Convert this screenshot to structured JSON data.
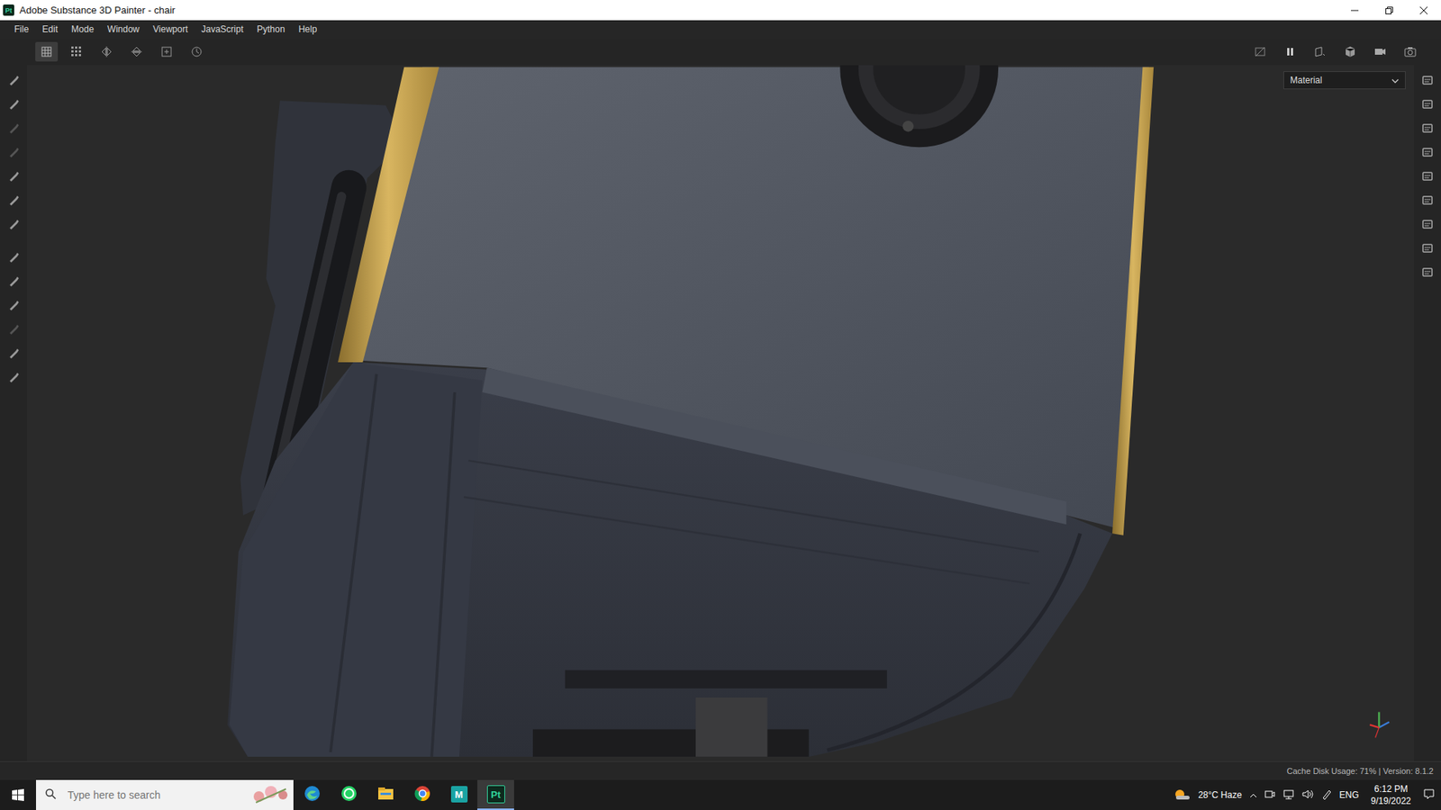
{
  "window": {
    "title": "Adobe Substance 3D Painter - chair",
    "app_badge": "Pt"
  },
  "menu": [
    "File",
    "Edit",
    "Mode",
    "Window",
    "Viewport",
    "JavaScript",
    "Python",
    "Help"
  ],
  "toolbar": {
    "tools": [
      {
        "selected": true
      },
      {
        "selected": false
      },
      {
        "selected": false
      },
      {
        "selected": false
      },
      {
        "selected": false
      },
      {
        "selected": false
      }
    ]
  },
  "viewport": {
    "mode_dropdown": "Material"
  },
  "status_bar": {
    "text": "Cache Disk Usage: 71% | Version: 8.1.2"
  },
  "taskbar": {
    "search_placeholder": "Type here to search",
    "apps": [
      {
        "kind": "edge",
        "selected": false
      },
      {
        "kind": "whatsapp",
        "selected": false
      },
      {
        "kind": "explorer",
        "selected": false
      },
      {
        "kind": "chrome",
        "selected": false
      },
      {
        "kind": "badge",
        "label": "M",
        "selected": false
      },
      {
        "kind": "badge",
        "label": "Pt",
        "selected": true
      }
    ],
    "weather": "28°C Haze",
    "language": "ENG",
    "time": "6:12 PM",
    "date": "9/19/2022"
  }
}
